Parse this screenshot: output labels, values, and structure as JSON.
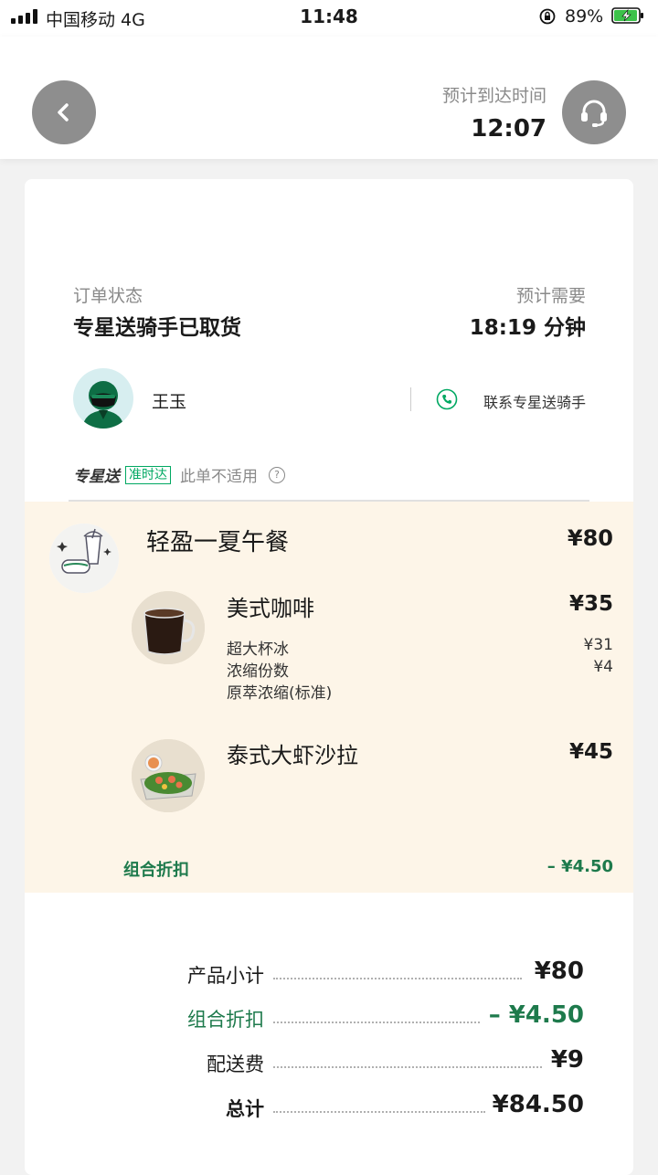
{
  "status_bar": {
    "carrier": "中国移动   4G",
    "time": "11:48",
    "battery_percent": "89%"
  },
  "header": {
    "eta_label": "预计到达时间",
    "eta_time": "12:07",
    "back_icon": "chevron-left-icon",
    "service_icon": "headset-icon"
  },
  "order": {
    "status_label": "订单状态",
    "status_value": "专星送骑手已取货",
    "need_label": "预计需要",
    "need_value": "18:19 分钟"
  },
  "rider": {
    "name": "王玉",
    "contact_label": "联系专星送骑手"
  },
  "brand": {
    "logo": "专星送",
    "badge": "准时达",
    "note": "此单不适用",
    "help": "?"
  },
  "items": {
    "combo": {
      "name": "轻盈一夏午餐",
      "price": "¥80"
    },
    "list": [
      {
        "name": "美式咖啡",
        "price": "¥35",
        "options": [
          {
            "label": "超大杯冰",
            "price": "¥31"
          },
          {
            "label": "浓缩份数",
            "price": "¥4"
          },
          {
            "label": "原萃浓缩(标准)",
            "price": ""
          }
        ]
      },
      {
        "name": "泰式大虾沙拉",
        "price": "¥45",
        "options": []
      }
    ],
    "discount_label": "组合折扣",
    "discount_value": "– ¥4.50"
  },
  "summary": {
    "subtotal_label": "产品小计",
    "subtotal_value": "¥80",
    "discount_label": "组合折扣",
    "discount_value": "– ¥4.50",
    "delivery_label": "配送费",
    "delivery_value": "¥9",
    "total_label": "总计",
    "total_value": "¥84.50"
  },
  "colors": {
    "accent_green": "#1e7a4c",
    "brand_green": "#00a862",
    "items_bg": "#fdf5e8",
    "button_grey": "#8e8e8e"
  }
}
